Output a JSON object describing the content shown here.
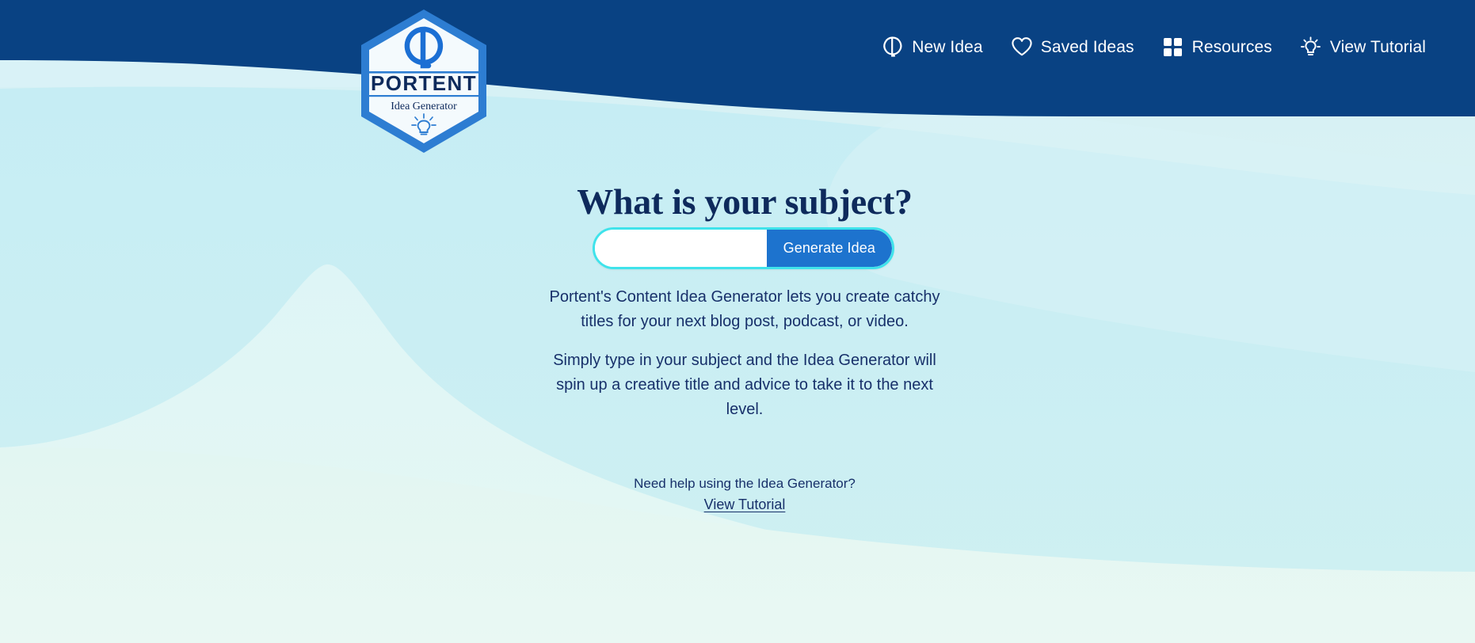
{
  "brand": {
    "name": "PORTENT",
    "tagline": "Idea Generator",
    "logo_mark_icon": "portent-circle-icon",
    "badge_bulb_icon": "lightbulb-icon"
  },
  "colors": {
    "header_navy": "#094283",
    "accent_blue": "#1D73CE",
    "border_cyan": "#3FE3EB",
    "title_navy": "#0E2A5C",
    "body_navy": "#17306A",
    "bg_light_cyan": "#CCEEF5",
    "bg_mint": "#DFF4F1",
    "logo_blue": "#2D7DD2"
  },
  "nav": {
    "items": [
      {
        "label": "New Idea",
        "icon": "portent-circle-icon"
      },
      {
        "label": "Saved Ideas",
        "icon": "heart-icon"
      },
      {
        "label": "Resources",
        "icon": "grid-icon"
      },
      {
        "label": "View Tutorial",
        "icon": "lightbulb-icon"
      }
    ]
  },
  "main": {
    "title": "What is your subject?",
    "search": {
      "value": "",
      "placeholder": "",
      "button_label": "Generate Idea"
    },
    "description": {
      "paragraph_1": "Portent's Content Idea Generator lets you create catchy titles for your next blog post, podcast, or video.",
      "paragraph_2": "Simply type in your subject and the Idea Generator will spin up a creative title and advice to take it to the next level."
    },
    "help": {
      "text": "Need help using the Idea Generator?",
      "link_label": "View Tutorial"
    }
  }
}
